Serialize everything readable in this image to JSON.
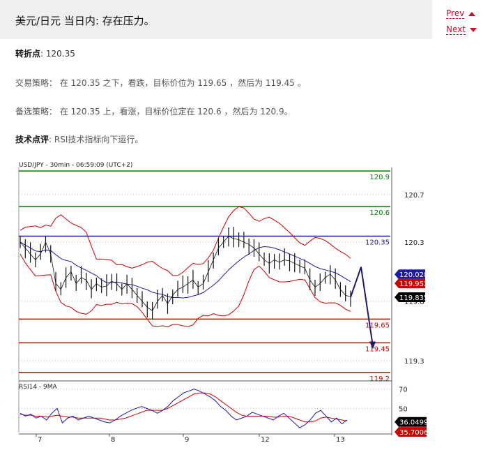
{
  "header": {
    "title": "美元/日元 当日内: 存在压力。"
  },
  "nav": {
    "prev": "Prev",
    "next": "Next"
  },
  "text": {
    "pivot_label": "转折点",
    "pivot_value": ": 120.35",
    "strategy_label": "交易策略：",
    "strategy_text": "在 120.35 之下，看跌，目标价位为 119.65 ，然后为 119.45 。",
    "alt_label": "备选策略：",
    "alt_text": "在 120.35 上，看涨，目标价位定在 120.6 ，然后为 120.9。",
    "tech_label": "技术点评",
    "tech_text": ": RSI技术指标向下运行。"
  },
  "colors": {
    "accent": "#c8102e",
    "green": "#008000",
    "blue": "#1a1aa6",
    "red": "#cc0000"
  },
  "chart_data": {
    "type": "line",
    "title": "USD/JPY - 30min - 06:59:09 (UTC+2)",
    "ylim": [
      119.14,
      120.93
    ],
    "y_ticks": [
      "120.7",
      "120.3",
      "119.8",
      "119.3"
    ],
    "x_ticks": [
      "7",
      "8",
      "9",
      "12",
      "13"
    ],
    "levels": [
      {
        "value": 120.9,
        "label": "120.9",
        "color": "#008000"
      },
      {
        "value": 120.6,
        "label": "120.6",
        "color": "#008000"
      },
      {
        "value": 120.35,
        "label": "120.35",
        "color": "#1a1aa6"
      },
      {
        "value": 119.65,
        "label": "119.65",
        "color": "#cc0000"
      },
      {
        "value": 119.45,
        "label": "119.45",
        "color": "#cc0000"
      },
      {
        "value": 119.2,
        "label": "119.2",
        "color": "#cc0000"
      }
    ],
    "price": [
      120.3,
      120.25,
      120.2,
      120.15,
      120.2,
      120.3,
      120.2,
      119.95,
      119.9,
      120.0,
      120.05,
      119.95,
      120.0,
      119.98,
      119.9,
      119.95,
      119.92,
      119.93,
      119.97,
      119.95,
      119.9,
      119.95,
      119.9,
      119.85,
      119.8,
      119.75,
      119.72,
      119.8,
      119.85,
      119.78,
      119.85,
      119.9,
      119.92,
      119.95,
      119.98,
      119.92,
      119.95,
      120.05,
      120.15,
      120.25,
      120.3,
      120.35,
      120.33,
      120.32,
      120.3,
      120.28,
      120.25,
      120.2,
      120.15,
      120.12,
      120.15,
      120.13,
      120.15,
      120.14,
      120.12,
      120.1,
      120.08,
      119.98,
      119.92,
      119.95,
      120.0,
      120.03,
      119.98,
      119.9,
      119.85,
      119.84
    ],
    "markers": [
      {
        "label": "120.028",
        "value": 120.028,
        "color": "#1a1aa6"
      },
      {
        "label": "119.952",
        "value": 119.952,
        "color": "#cc0000"
      },
      {
        "label": "119.835",
        "value": 119.835,
        "color": "#000000"
      }
    ],
    "projection": [
      119.835,
      120.09,
      119.42
    ],
    "rsi": {
      "title": "RSI14 - 9MA",
      "ylim": [
        25,
        77
      ],
      "y_ticks": [
        "70",
        "50"
      ],
      "values": [
        45,
        42,
        44,
        40,
        42,
        38,
        45,
        50,
        35,
        40,
        42,
        38,
        40,
        42,
        40,
        38,
        36,
        35,
        38,
        42,
        45,
        48,
        50,
        52,
        50,
        48,
        45,
        48,
        52,
        58,
        62,
        66,
        68,
        70,
        68,
        65,
        62,
        58,
        52,
        48,
        42,
        38,
        40,
        42,
        46,
        44,
        42,
        40,
        38,
        42,
        45,
        40,
        35,
        30,
        33,
        38,
        45,
        48,
        42,
        36,
        40,
        34,
        38
      ],
      "ma": [
        44,
        43,
        43,
        42,
        42,
        41,
        42,
        43,
        42,
        41,
        41,
        40,
        40,
        40,
        40,
        40,
        39,
        38,
        38,
        39,
        40,
        42,
        44,
        46,
        48,
        48,
        48,
        48,
        50,
        53,
        56,
        59,
        62,
        65,
        66,
        66,
        65,
        62,
        58,
        54,
        50,
        46,
        43,
        42,
        42,
        42,
        42,
        42,
        41,
        41,
        42,
        42,
        40,
        38,
        36,
        36,
        37,
        40,
        41,
        40,
        39,
        38,
        37
      ],
      "markers": [
        {
          "label": "36.0499",
          "value": 36.0499,
          "color": "#000000"
        },
        {
          "label": "35.7006",
          "value": 35.7006,
          "color": "#cc0000"
        }
      ]
    }
  }
}
